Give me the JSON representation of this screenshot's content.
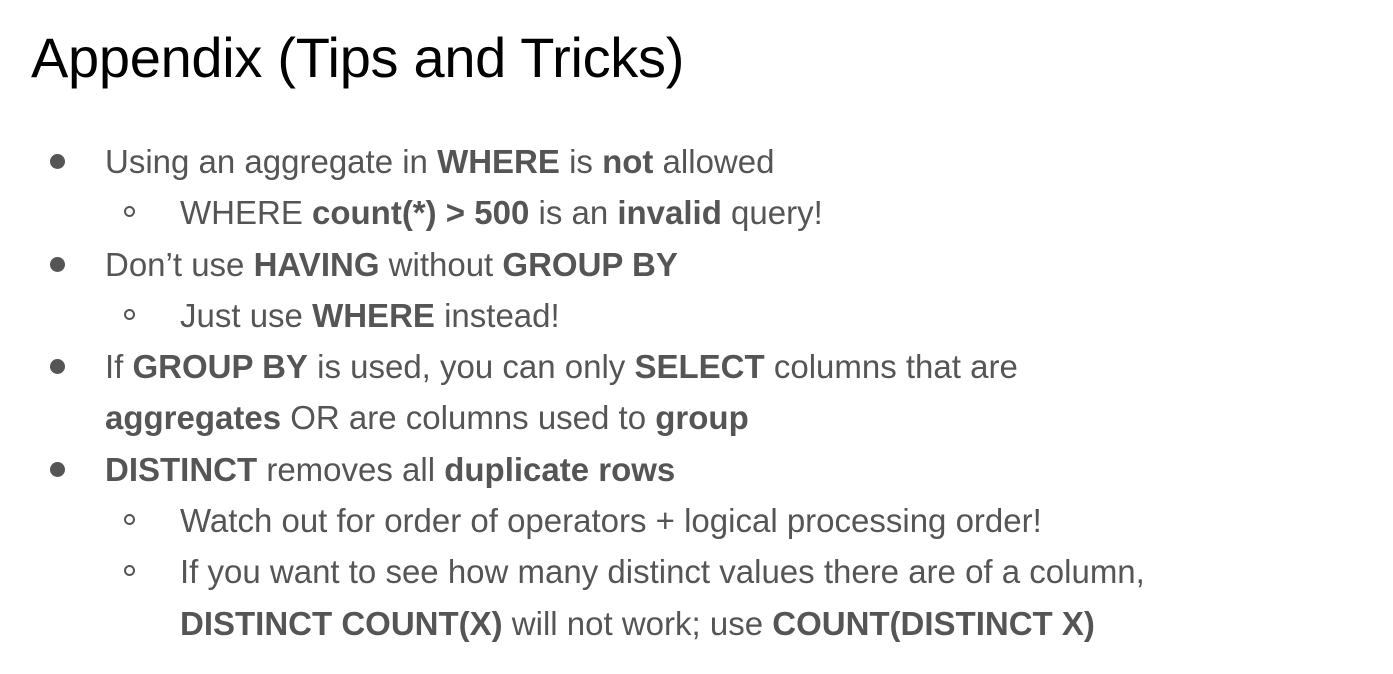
{
  "title": "Appendix (Tips and Tricks)",
  "items": [
    {
      "text": {
        "p1": "Using an aggregate in ",
        "b1": "WHERE",
        "p2": " is ",
        "b2": "not",
        "p3": " allowed"
      },
      "subitems": [
        {
          "p1": "WHERE ",
          "b1": "count(*) > 500",
          "p2": " is an ",
          "b2": "invalid",
          "p3": " query!"
        }
      ]
    },
    {
      "text": {
        "p1": "Don’t use ",
        "b1": "HAVING",
        "p2": " without ",
        "b2": "GROUP BY"
      },
      "subitems": [
        {
          "p1": "Just use ",
          "b1": "WHERE",
          "p2": " instead!"
        }
      ]
    },
    {
      "text": {
        "p1": "If ",
        "b1": "GROUP BY",
        "p2": " is used, you can only ",
        "b2": "SELECT",
        "p3": " columns that are",
        "b3": "aggregates",
        "p4": " OR are columns used to ",
        "b4": "group"
      },
      "subitems": []
    },
    {
      "text": {
        "b1": "DISTINCT",
        "p1": " removes all ",
        "b2": "duplicate rows"
      },
      "subitems": [
        {
          "p1": "Watch out for order of operators + logical processing order!"
        },
        {
          "p1": "If you want to see how many distinct values there are of a column,",
          "b1": "DISTINCT COUNT(X)",
          "p2": " will not work; use ",
          "b2": "COUNT(DISTINCT X)"
        }
      ]
    }
  ]
}
